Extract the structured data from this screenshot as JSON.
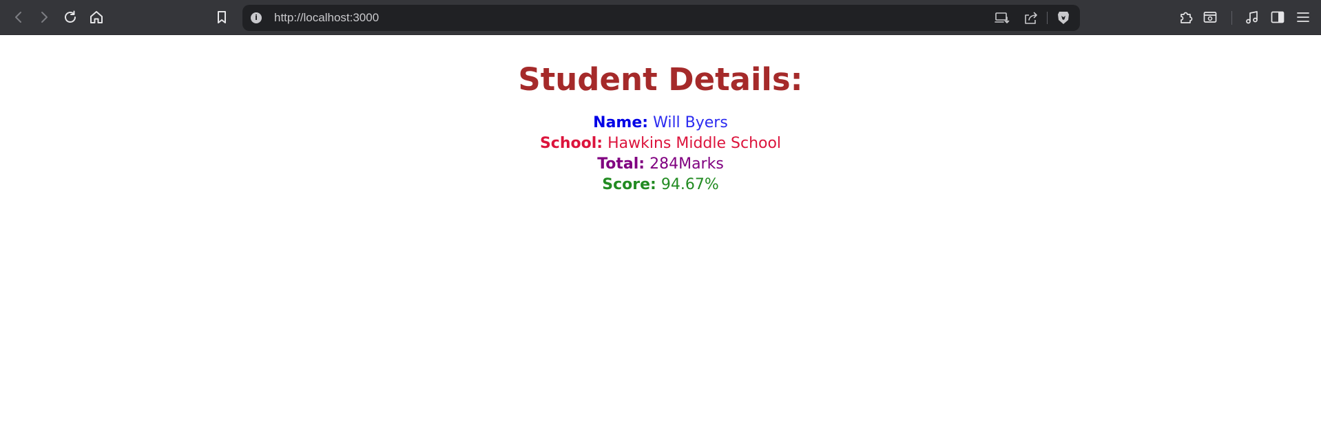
{
  "browser": {
    "url": "http://localhost:3000",
    "icons": {
      "back": "back-arrow-icon",
      "forward": "forward-arrow-icon",
      "reload": "reload-icon",
      "home": "home-icon",
      "bookmark": "bookmark-icon",
      "site_info": "info-icon",
      "install": "install-app-icon",
      "share": "share-icon",
      "brave": "brave-shield-icon",
      "extensions": "puzzle-icon",
      "wallet": "wallet-icon",
      "media": "music-note-icon",
      "sidebar": "sidebar-icon",
      "menu": "hamburger-menu-icon"
    }
  },
  "page": {
    "heading": "Student Details:",
    "heading_color": "#a52a2a",
    "details": [
      {
        "label": "Name:",
        "value": "Will Byers",
        "label_color": "#0000e6",
        "value_color": "#2b2bf0"
      },
      {
        "label": "School:",
        "value": "Hawkins Middle School",
        "label_color": "#dc143c",
        "value_color": "#dc143c"
      },
      {
        "label": "Total:",
        "value": "284Marks",
        "label_color": "#800080",
        "value_color": "#800080"
      },
      {
        "label": "Score:",
        "value": "94.67%",
        "label_color": "#228b22",
        "value_color": "#228b22"
      }
    ]
  }
}
